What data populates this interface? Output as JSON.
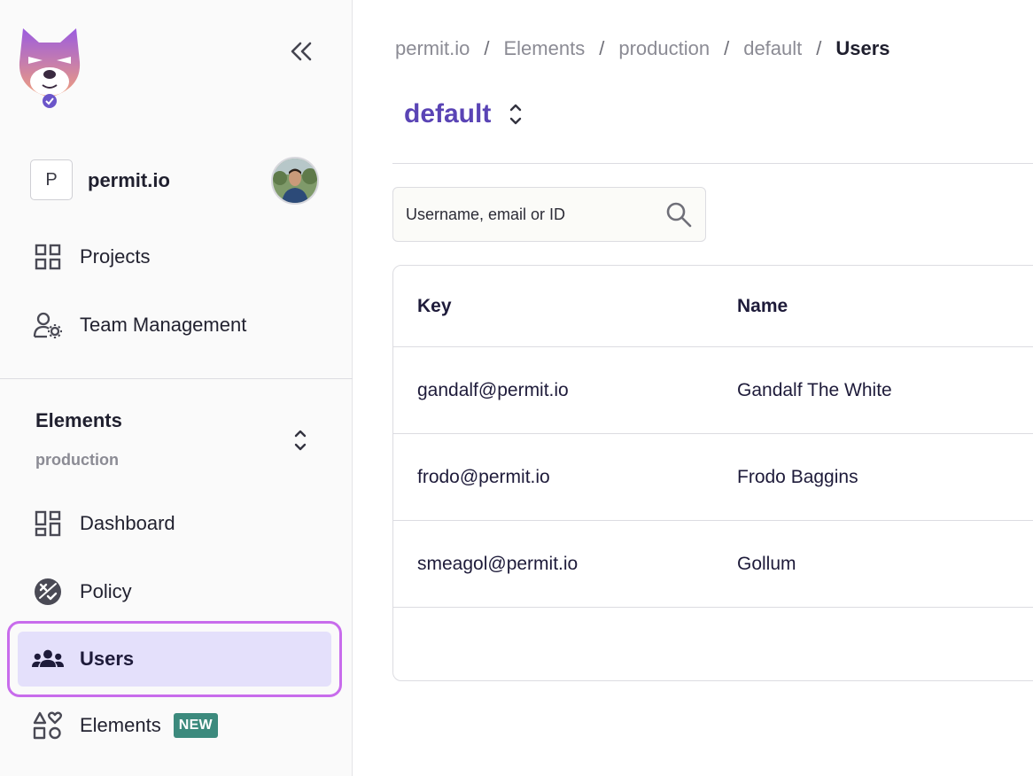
{
  "sidebar": {
    "org": {
      "initial": "P",
      "name": "permit.io"
    },
    "top_nav": [
      {
        "label": "Projects",
        "icon": "grid-icon"
      },
      {
        "label": "Team Management",
        "icon": "user-gear-icon"
      }
    ],
    "environment": {
      "project": "Elements",
      "environment": "production"
    },
    "env_nav": [
      {
        "label": "Dashboard",
        "icon": "dashboard-icon"
      },
      {
        "label": "Policy",
        "icon": "policy-icon"
      },
      {
        "label": "Users",
        "icon": "users-icon",
        "active": true
      },
      {
        "label": "Elements",
        "icon": "shapes-icon",
        "badge": "NEW"
      }
    ]
  },
  "breadcrumb": [
    "permit.io",
    "Elements",
    "production",
    "default",
    "Users"
  ],
  "tenant": {
    "name": "default"
  },
  "search": {
    "placeholder": "Username, email or ID",
    "value": ""
  },
  "table": {
    "columns": [
      "Key",
      "Name"
    ],
    "rows": [
      {
        "key": "gandalf@permit.io",
        "name": "Gandalf The White"
      },
      {
        "key": "frodo@permit.io",
        "name": "Frodo Baggins"
      },
      {
        "key": "smeagol@permit.io",
        "name": "Gollum"
      }
    ]
  },
  "colors": {
    "accent": "#5a44b5",
    "active_bg": "#e4e0fb",
    "highlight_ring": "#c86cec",
    "badge": "#3c8a7d"
  }
}
